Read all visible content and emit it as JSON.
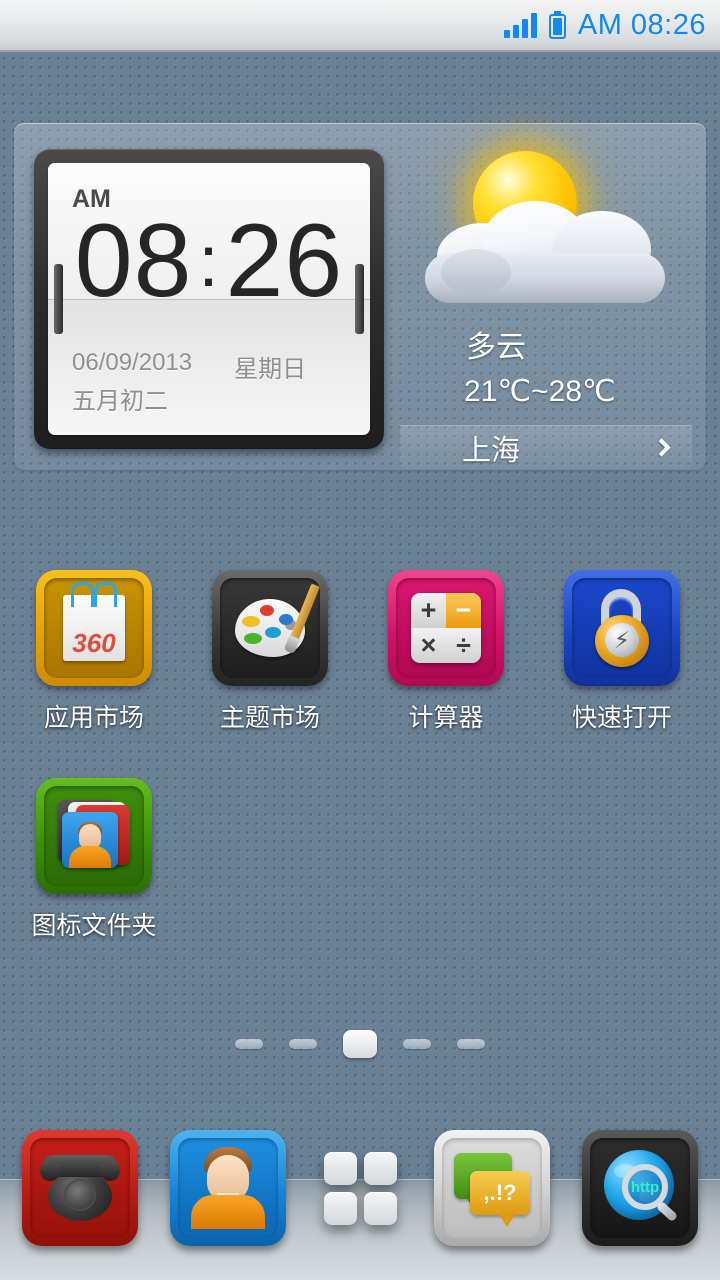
{
  "status_bar": {
    "time": "AM 08:26",
    "signal_icon": "signal-bars-icon",
    "signal_bars": 4,
    "battery_icon": "battery-full-icon",
    "accent_color": "#1189f0"
  },
  "clock_widget": {
    "meridiem": "AM",
    "hours": "08",
    "separator": ":",
    "minutes": "26",
    "date": "06/09/2013",
    "weekday": "星期日",
    "lunar_date": "五月初二"
  },
  "weather_widget": {
    "icon": "sun-behind-cloud-icon",
    "condition": "多云",
    "temperature_range": "21℃~28℃",
    "city": "上海",
    "chevron_icon": "chevron-right-icon"
  },
  "app_grid": {
    "rows": [
      [
        {
          "label": "应用市场",
          "icon": "app-market-icon",
          "color": "#e8a206",
          "badge": "360"
        },
        {
          "label": "主题市场",
          "icon": "theme-market-palette-icon",
          "color": "#3a3a3a"
        },
        {
          "label": "计算器",
          "icon": "calculator-icon",
          "color": "#d41267",
          "keys": [
            "+",
            "−",
            "×",
            "÷"
          ]
        },
        {
          "label": "快速打开",
          "icon": "quick-open-padlock-icon",
          "color": "#1b45c4",
          "glyph": "⚡"
        }
      ],
      [
        {
          "label": "图标文件夹",
          "icon": "icon-folder-icon",
          "color": "#3d9108"
        }
      ]
    ]
  },
  "page_indicator": {
    "total": 5,
    "active_index": 2
  },
  "dock": {
    "items": [
      {
        "name": "phone",
        "icon": "rotary-phone-icon",
        "color": "#b81d16"
      },
      {
        "name": "contacts",
        "icon": "contact-person-icon",
        "color": "#1682d6"
      },
      {
        "name": "app-drawer",
        "icon": "app-drawer-grid-icon",
        "color": "#dfe4e7"
      },
      {
        "name": "messaging",
        "icon": "speech-bubbles-icon",
        "color": "#cfcfcf",
        "bubble_text": ",.!?"
      },
      {
        "name": "browser",
        "icon": "globe-magnifier-icon",
        "color": "#1b1b1b",
        "globe_text": "http"
      }
    ]
  },
  "wallpaper": {
    "base_color": "#6b8296",
    "pattern": "dotted-denim-texture"
  }
}
